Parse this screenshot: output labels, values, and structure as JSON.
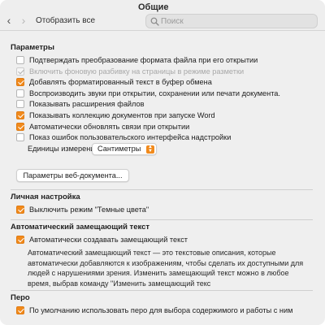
{
  "window": {
    "title": "Общие",
    "show_all_label": "Отобразить все",
    "search_placeholder": "Поиск",
    "nav_back": "‹",
    "nav_forward": "›"
  },
  "sections": {
    "params": {
      "title": "Параметры",
      "items": [
        {
          "label": "Подтверждать преобразование формата файла при его открытии",
          "state": "unchecked"
        },
        {
          "label": "Включить фоновую разбивку на страницы в режиме разметки",
          "state": "disabled-checked"
        },
        {
          "label": "Добавлять форматированный текст в буфер обмена",
          "state": "checked"
        },
        {
          "label": "Воспроизводить звуки при открытии, сохранении или печати документа.",
          "state": "unchecked"
        },
        {
          "label": "Показывать расширения файлов",
          "state": "unchecked"
        },
        {
          "label": "Показывать коллекцию документов при запуске Word",
          "state": "checked"
        },
        {
          "label": "Автоматически обновлять связи при открытии",
          "state": "checked"
        },
        {
          "label": "Показ ошибок пользовательского интерфейса надстройки",
          "state": "unchecked"
        }
      ],
      "units_label": "Единицы измерения:",
      "units_value": "Сантиметры",
      "web_doc_button": "Параметры веб-документа..."
    },
    "personal": {
      "title": "Личная настройка",
      "dark_mode_label": "Выключить режим \"Темные цвета\"",
      "dark_mode_state": "checked"
    },
    "alt_text": {
      "title": "Автоматический замещающий текст",
      "auto_label": "Автоматически создавать замещающий текст",
      "auto_state": "checked",
      "description_lines": [
        "Автоматический замещающий текст — это текстовые описания, которые",
        "автоматически добавляются к изображениям, чтобы сделать их доступными для",
        "людей с нарушениями зрения. Изменить замещающий текст можно в любое",
        "время, выбрав команду \"Изменить замещающий текс"
      ]
    },
    "pen": {
      "title": "Перо",
      "default_pen_label": "По умолчанию использовать перо для выбора содержимого и работы с ним",
      "default_pen_state": "checked"
    }
  },
  "colors": {
    "accent": "#f18a1c",
    "window_bg": "#efefef"
  }
}
